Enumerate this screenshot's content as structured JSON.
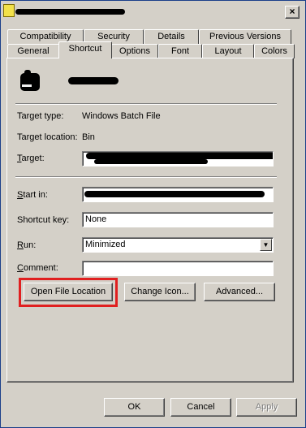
{
  "titlebar": {
    "close_label": "×"
  },
  "tabs": {
    "row1": [
      "Compatibility",
      "Security",
      "Details",
      "Previous Versions"
    ],
    "row2": [
      "General",
      "Shortcut",
      "Options",
      "Font",
      "Layout",
      "Colors"
    ],
    "active": "Shortcut"
  },
  "shortcut": {
    "target_type_label": "Target type:",
    "target_type_value": "Windows Batch File",
    "target_location_label": "Target location:",
    "target_location_value": "Bin",
    "target_label": "Target:",
    "start_in_label": "Start in:",
    "shortcut_key_label": "Shortcut key:",
    "shortcut_key_value": "None",
    "run_label": "Run:",
    "run_value": "Minimized",
    "comment_label": "Comment:",
    "comment_value": "",
    "open_file_location": "Open File Location",
    "change_icon": "Change Icon...",
    "advanced": "Advanced..."
  },
  "footer": {
    "ok": "OK",
    "cancel": "Cancel",
    "apply": "Apply"
  },
  "colors": {
    "highlight": "#e02020",
    "dialog_bg": "#d4d0c8"
  }
}
